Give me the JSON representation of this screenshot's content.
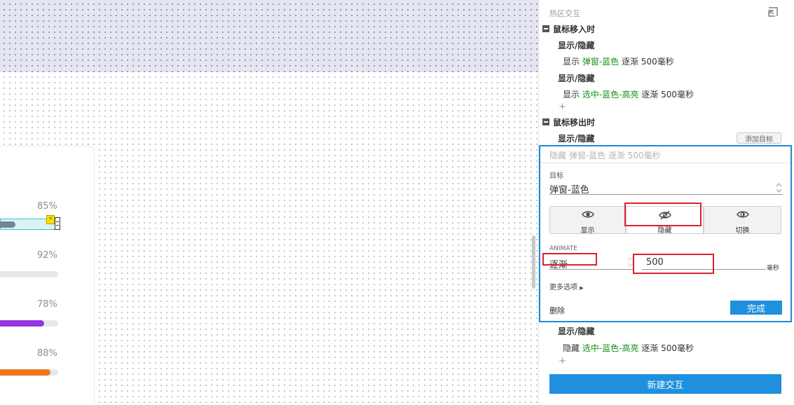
{
  "canvas": {
    "bars": [
      {
        "percent_label": "85%",
        "value": 0.85,
        "color": "#6e8791"
      },
      {
        "percent_label": "92%",
        "value": 0.92,
        "color": "#e6e7ea"
      },
      {
        "percent_label": "78%",
        "value": 0.78,
        "color": "#9335e0"
      },
      {
        "percent_label": "88%",
        "value": 0.88,
        "color": "#f0741a"
      }
    ],
    "lightning_glyph": "⚡"
  },
  "panel": {
    "title": "热区交互",
    "collapse_icon": "shrink-icon",
    "events": [
      {
        "label": "鼠标移入时",
        "actions": [
          {
            "type": "显示/隐藏",
            "verb": "显示",
            "target": "弹窗-蓝色",
            "detail": "逐渐 500毫秒"
          },
          {
            "type": "显示/隐藏",
            "verb": "显示",
            "target": "选中-蓝色-高亮",
            "detail": "逐渐 500毫秒"
          }
        ],
        "add_symbol": "+"
      },
      {
        "label": "鼠标移出时",
        "first_action_type": "显示/隐藏",
        "add_target_button": "添加目标"
      }
    ],
    "editor": {
      "summary": "隐藏 弹窗-蓝色 逐渐 500毫秒",
      "target_label": "目标",
      "target_value": "弹窗-蓝色",
      "modes": [
        {
          "label": "显示",
          "icon": "eye-icon"
        },
        {
          "label": "隐藏",
          "icon": "eye-off-icon"
        },
        {
          "label": "切换",
          "icon": "eye-toggle-icon"
        }
      ],
      "selected_mode": "隐藏",
      "animate_label": "ANIMATE",
      "animate_value": "逐渐",
      "duration_value": "500",
      "duration_unit": "毫秒",
      "more_options": "更多选项",
      "delete_label": "删除",
      "done_label": "完成"
    },
    "after_editor": {
      "action_type": "显示/隐藏",
      "verb": "隐藏",
      "target": "选中-蓝色-高亮",
      "detail": "逐渐 500毫秒",
      "add_symbol": "+"
    },
    "new_interaction": "新建交互"
  }
}
